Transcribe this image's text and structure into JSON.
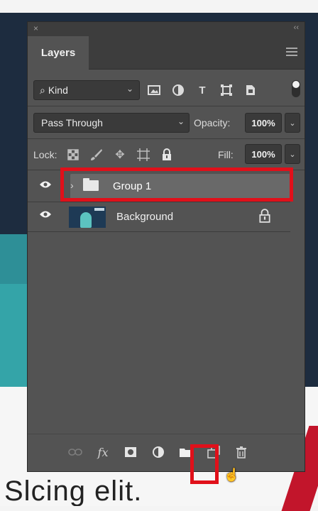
{
  "panel": {
    "tab_label": "Layers",
    "close_glyph": "×",
    "collapse_glyph": "‹‹"
  },
  "filter": {
    "kind_label": "Kind",
    "icons": [
      "image-filter-icon",
      "adjustment-filter-icon",
      "type-filter-icon",
      "shape-filter-icon",
      "smart-object-filter-icon"
    ]
  },
  "blend": {
    "mode": "Pass Through",
    "opacity_label": "Opacity:",
    "opacity_value": "100%"
  },
  "lock": {
    "label": "Lock:",
    "fill_label": "Fill:",
    "fill_value": "100%"
  },
  "layers": [
    {
      "name": "Group 1",
      "type": "group",
      "visible": true,
      "selected": true
    },
    {
      "name": "Background",
      "type": "image",
      "visible": true,
      "locked": true
    }
  ],
  "bottom_toolbar": {
    "icons": [
      "link-layers-icon",
      "layer-style-fx-icon",
      "add-mask-icon",
      "adjustment-layer-icon",
      "new-group-folder-icon",
      "new-layer-icon",
      "delete-layer-icon"
    ],
    "fx_label": "fx"
  },
  "background_caption": "Slcing elit."
}
